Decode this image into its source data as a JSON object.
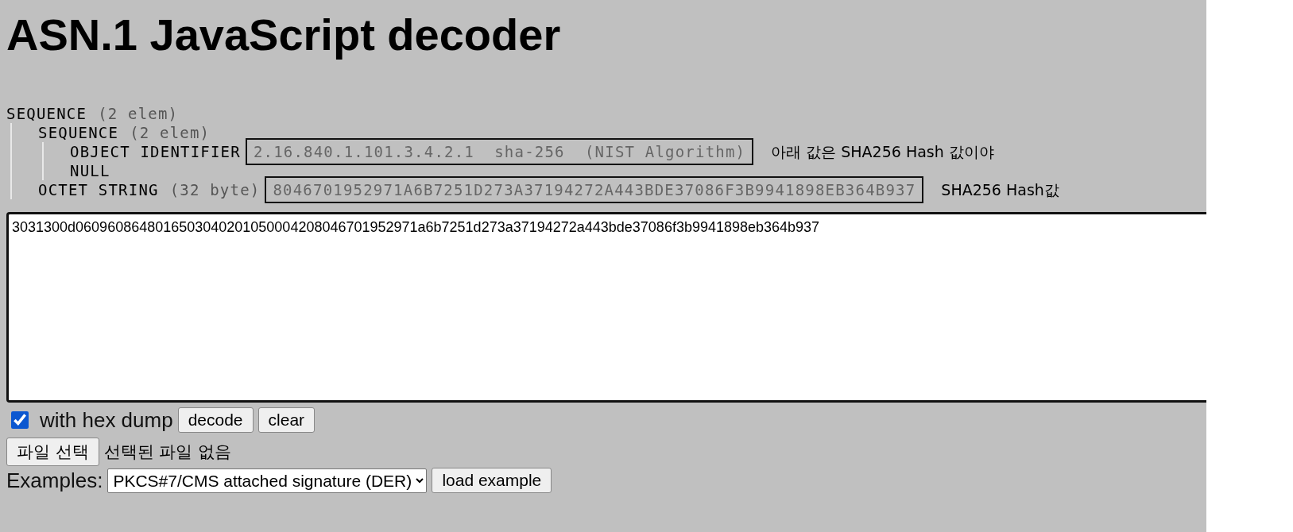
{
  "title": "ASN.1 JavaScript decoder",
  "tree": [
    {
      "label": "SEQUENCE",
      "info": "(2 elem)",
      "children": [
        {
          "label": "SEQUENCE",
          "info": "(2 elem)",
          "children": [
            {
              "label": "OBJECT IDENTIFIER",
              "value": "2.16.840.1.101.3.4.2.1  sha-256  (NIST Algorithm)",
              "note": "아래 값은 SHA256 Hash 값이야"
            },
            {
              "label": "NULL"
            }
          ]
        },
        {
          "label": "OCTET STRING",
          "info": "(32 byte)",
          "value": "8046701952971A6B7251D273A37194272A443BDE37086F3B9941898EB364B937",
          "note": "SHA256 Hash값"
        }
      ]
    }
  ],
  "input": {
    "value": "3031300d0609608648016503040201050004208046701952971a6b7251d273a37194272a443bde37086f3b9941898eb364b937"
  },
  "hex_dump": {
    "label": "with hex dump",
    "checked": true
  },
  "buttons": [
    "decode",
    "clear"
  ],
  "file": {
    "button": "파일 선택",
    "status": "선택된 파일 없음"
  },
  "examples": {
    "label": "Examples:",
    "selected": "PKCS#7/CMS attached signature (DER)",
    "button": "load example"
  }
}
